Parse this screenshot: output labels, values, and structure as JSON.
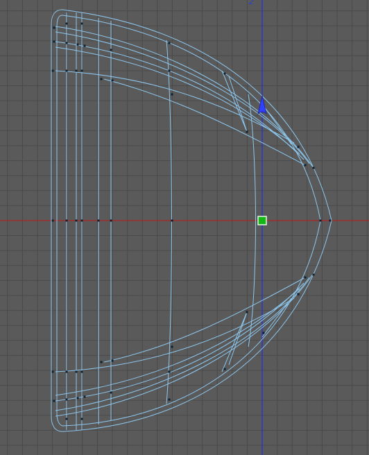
{
  "viewport": {
    "axis_label_z": "Z",
    "colors": {
      "background": "#5a5a5a",
      "grid": "#4a4a4a",
      "x_axis": "#c01818",
      "z_axis": "#1e2ee0",
      "wireframe": "#8ec7ee",
      "vertex": "#10202e",
      "pivot_fill": "#14b814",
      "gizmo_arrow": "#3040ff"
    },
    "icons": [
      "move-gizmo-arrow-icon",
      "pivot-handle-icon"
    ]
  }
}
